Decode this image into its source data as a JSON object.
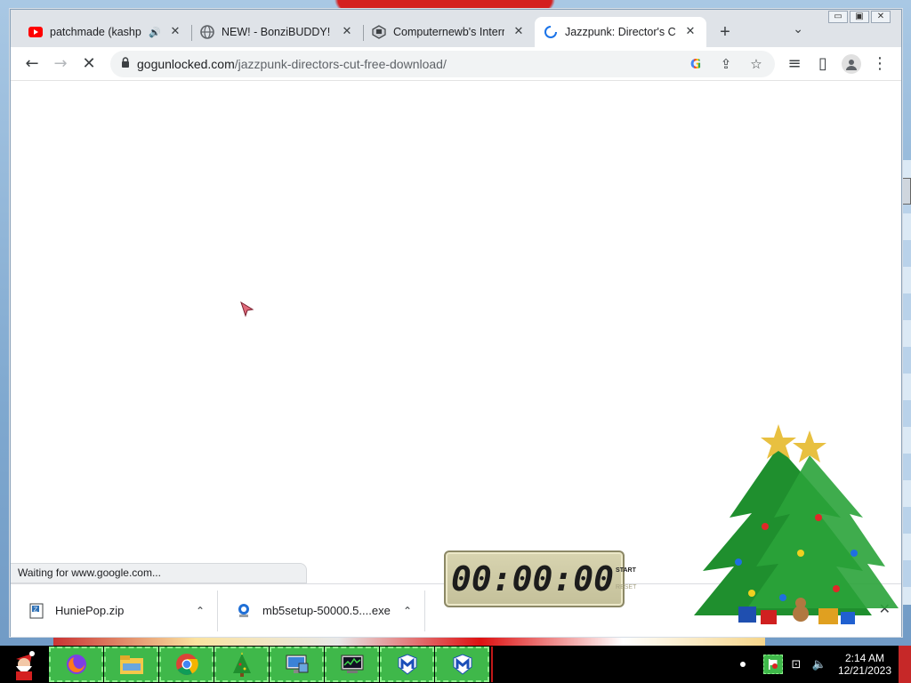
{
  "window": {
    "controls": [
      "▭",
      "▣",
      "✕"
    ]
  },
  "tabs": [
    {
      "title": "patchmade (kashpa",
      "close": "✕",
      "audio": "🔊",
      "favicon": "youtube-icon"
    },
    {
      "title": "NEW! - BonziBUDDY!",
      "close": "✕",
      "favicon": "globe-icon"
    },
    {
      "title": "Computernewb's Interne",
      "close": "✕",
      "favicon": "computernewb-icon"
    },
    {
      "title": "Jazzpunk: Director's Cut",
      "close": "✕",
      "favicon": "loading-spinner-icon",
      "active": true
    }
  ],
  "new_tab_label": "+",
  "tab_search": "⌄",
  "toolbar": {
    "back": "←",
    "forward": "→",
    "stop": "✕",
    "url_host": "gogunlocked.com",
    "url_path": "/jazzpunk-directors-cut-free-download/",
    "google_label": "G",
    "share": "⇪",
    "bookmark": "☆",
    "media": "≡",
    "sidepanel": "▯",
    "menu": "⋮"
  },
  "status_text": "Waiting for www.google.com...",
  "downloads": [
    {
      "name": "HuniePop.zip",
      "caret": "⌃",
      "icon": "zip-file-icon"
    },
    {
      "name": "mb5setup-50000.5....exe",
      "caret": "⌃",
      "icon": "installer-icon"
    }
  ],
  "downloads_close": "✕",
  "timer": {
    "display": "00:00:00",
    "start_label": "START",
    "reset_label": "RESET"
  },
  "taskbar": {
    "apps": [
      "firefox-icon",
      "file-explorer-icon",
      "chrome-icon",
      "christmas-tree-icon",
      "remote-desktop-icon",
      "task-manager-icon",
      "malwarebytes-icon",
      "malwarebytes-icon"
    ]
  },
  "tray": {
    "time": "2:14 AM",
    "date": "12/21/2023",
    "network": "⊡",
    "volume": "🔈"
  },
  "colors": {
    "taskbar_app": "#3fb84a",
    "chrome_tab_strip": "#dfe3e8"
  }
}
